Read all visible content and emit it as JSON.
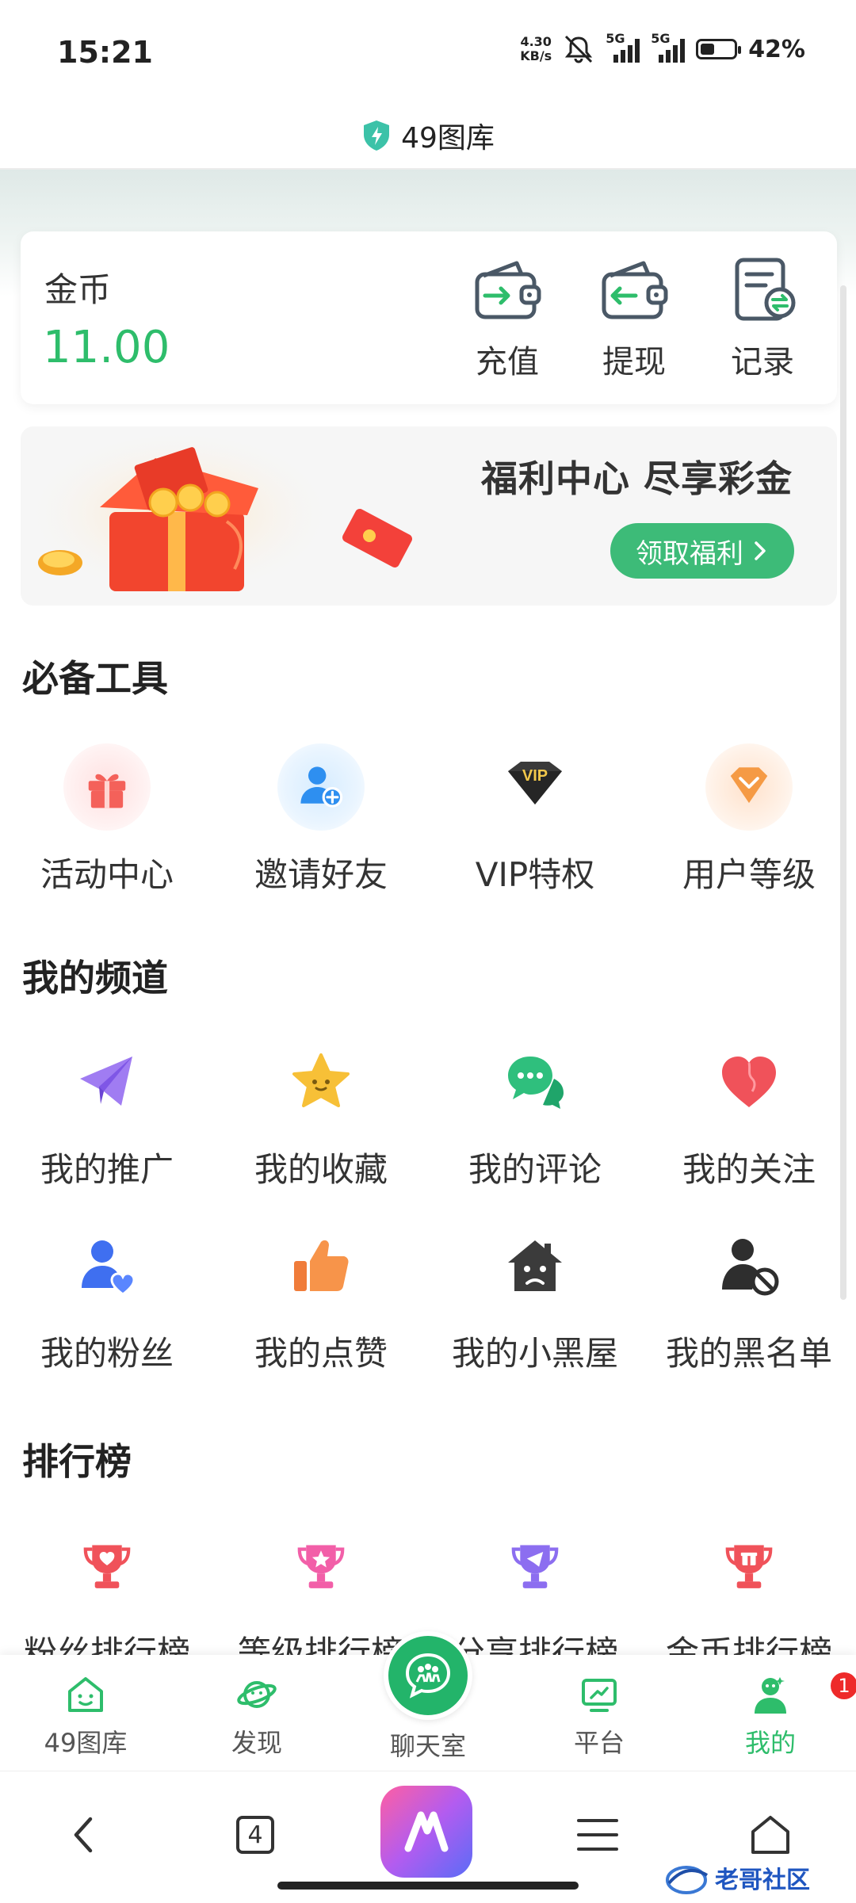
{
  "status_bar": {
    "time": "15:21",
    "net_speed_value": "4.30",
    "net_speed_unit": "KB/s",
    "sim1": "5G",
    "sim2": "5G",
    "battery": "42%",
    "battery_level": 0.42
  },
  "header": {
    "title": "49图库",
    "icon": "shield-icon"
  },
  "wallet": {
    "label": "金币",
    "value": "11.00",
    "actions": [
      {
        "label": "充值",
        "icon": "wallet-in-icon"
      },
      {
        "label": "提现",
        "icon": "wallet-out-icon"
      },
      {
        "label": "记录",
        "icon": "record-icon"
      }
    ]
  },
  "welfare": {
    "title": "福利中心 尽享彩金",
    "button": "领取福利"
  },
  "tools": {
    "title": "必备工具",
    "items": [
      {
        "label": "活动中心",
        "icon": "gift-icon"
      },
      {
        "label": "邀请好友",
        "icon": "add-user-icon"
      },
      {
        "label": "VIP特权",
        "icon": "vip-badge-icon",
        "badge_text": "VIP"
      },
      {
        "label": "用户等级",
        "icon": "level-icon"
      }
    ]
  },
  "channels": {
    "title": "我的频道",
    "items": [
      {
        "label": "我的推广",
        "icon": "paper-plane-icon"
      },
      {
        "label": "我的收藏",
        "icon": "star-icon"
      },
      {
        "label": "我的评论",
        "icon": "chat-bubble-icon"
      },
      {
        "label": "我的关注",
        "icon": "heart-icon"
      },
      {
        "label": "我的粉丝",
        "icon": "user-heart-icon"
      },
      {
        "label": "我的点赞",
        "icon": "thumbs-up-icon"
      },
      {
        "label": "我的小黑屋",
        "icon": "sad-house-icon"
      },
      {
        "label": "我的黑名单",
        "icon": "user-blocked-icon"
      }
    ]
  },
  "ranking": {
    "title": "排行榜",
    "items": [
      {
        "label": "粉丝排行榜",
        "icon": "trophy-heart-icon"
      },
      {
        "label": "等级排行榜",
        "icon": "trophy-star-icon"
      },
      {
        "label": "分享排行榜",
        "icon": "trophy-share-icon"
      },
      {
        "label": "金币排行榜",
        "icon": "trophy-gift-icon"
      }
    ]
  },
  "tab_bar": {
    "items": [
      {
        "label": "49图库",
        "icon": "home-house-icon"
      },
      {
        "label": "发现",
        "icon": "planet-icon"
      },
      {
        "label": "聊天室",
        "icon": "chat-room-icon"
      },
      {
        "label": "平台",
        "icon": "monitor-icon"
      },
      {
        "label": "我的",
        "icon": "profile-icon"
      }
    ],
    "badge": "1",
    "active": "我的"
  },
  "browser_nav": {
    "tab_count": "4",
    "watermark": "老哥社区"
  },
  "colors": {
    "accent_green": "#2ebd6b",
    "button_green": "#3dbb78",
    "badge_red": "#ee2a2a"
  }
}
